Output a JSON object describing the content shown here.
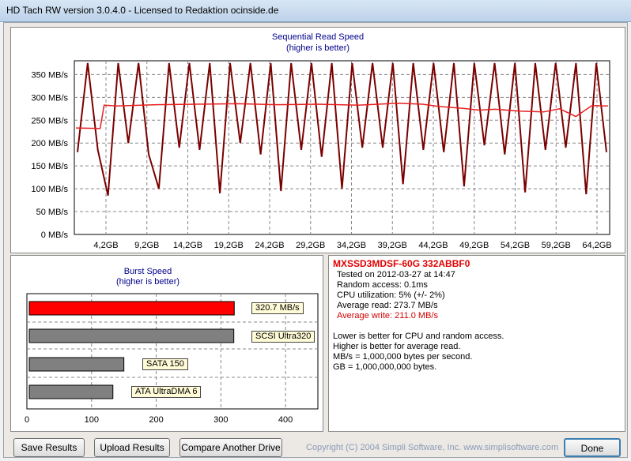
{
  "window": {
    "title": "HD Tach RW version 3.0.4.0 - Licensed to Redaktion ocinside.de"
  },
  "sequential": {
    "title": "Sequential Read Speed",
    "subtitle": "(higher is better)"
  },
  "chart_data": [
    {
      "type": "line",
      "title": "Sequential Read Speed",
      "subtitle": "(higher is better)",
      "ylim": [
        0,
        350
      ],
      "y_ticks": [
        "0 MB/s",
        "50 MB/s",
        "100 MB/s",
        "150 MB/s",
        "200 MB/s",
        "250 MB/s",
        "300 MB/s",
        "350 MB/s"
      ],
      "x_ticks": [
        "4,2GB",
        "9,2GB",
        "14,2GB",
        "19,2GB",
        "24,2GB",
        "29,2GB",
        "34,2GB",
        "39,2GB",
        "44,2GB",
        "49,2GB",
        "54,2GB",
        "59,2GB",
        "64,2GB"
      ],
      "grid": true,
      "series": [
        {
          "color": "#e82020",
          "x_gb": [
            0,
            3,
            3.5,
            5,
            10,
            15,
            20,
            25,
            30,
            35,
            40,
            43,
            45,
            48,
            50,
            52,
            55,
            58,
            60,
            62,
            64,
            66
          ],
          "values": [
            233,
            232,
            283,
            281,
            284,
            285,
            286,
            284,
            285,
            283,
            287,
            285,
            280,
            276,
            272,
            274,
            270,
            268,
            275,
            258,
            282,
            281
          ]
        },
        {
          "color": "#7a0000",
          "values": [
            180,
            382,
            185,
            85,
            382,
            200,
            375,
            175,
            100,
            380,
            190,
            382,
            185,
            382,
            90,
            380,
            200,
            382,
            175,
            382,
            95,
            380,
            185,
            382,
            170,
            382,
            100,
            380,
            190,
            382,
            190,
            382,
            110,
            380,
            185,
            382,
            180,
            382,
            105,
            380,
            195,
            382,
            175,
            382,
            92,
            380,
            185,
            382,
            190,
            382,
            88,
            382,
            180
          ]
        }
      ]
    },
    {
      "type": "bar",
      "title": "Burst Speed",
      "subtitle": "(higher is better)",
      "xlim": [
        0,
        450
      ],
      "x_ticks": [
        "0",
        "100",
        "200",
        "300",
        "400"
      ],
      "bars": [
        {
          "label": "320.7 MB/s",
          "value": 320.7,
          "color": "#ff0000"
        },
        {
          "label": "SCSI Ultra320",
          "value": 320,
          "color": "#808080"
        },
        {
          "label": "SATA 150",
          "value": 150,
          "color": "#808080"
        },
        {
          "label": "ATA UltraDMA 6",
          "value": 133,
          "color": "#808080"
        }
      ]
    }
  ],
  "info": {
    "drive": "MXSSD3MDSF-60G 332ABBF0",
    "tested": "Tested on 2012-03-27 at 14:47",
    "random_access": "Random access: 0.1ms",
    "cpu": "CPU utilization: 5% (+/- 2%)",
    "avg_read": "Average read: 273.7 MB/s",
    "avg_write": "Average write: 211.0 MB/s",
    "notes": [
      "Lower is better for CPU and random access.",
      "Higher is better for average read.",
      "MB/s = 1,000,000 bytes per second.",
      "GB = 1,000,000,000 bytes."
    ]
  },
  "buttons": {
    "save": "Save Results",
    "upload": "Upload Results",
    "compare": "Compare Another Drive",
    "done": "Done"
  },
  "copyright": "Copyright (C) 2004 Simpli Software, Inc. www.simplisoftware.com",
  "colors": {
    "read": "#e82020",
    "write": "#7a0000",
    "title_blue": "#00008b",
    "drive_red": "#e00000"
  }
}
